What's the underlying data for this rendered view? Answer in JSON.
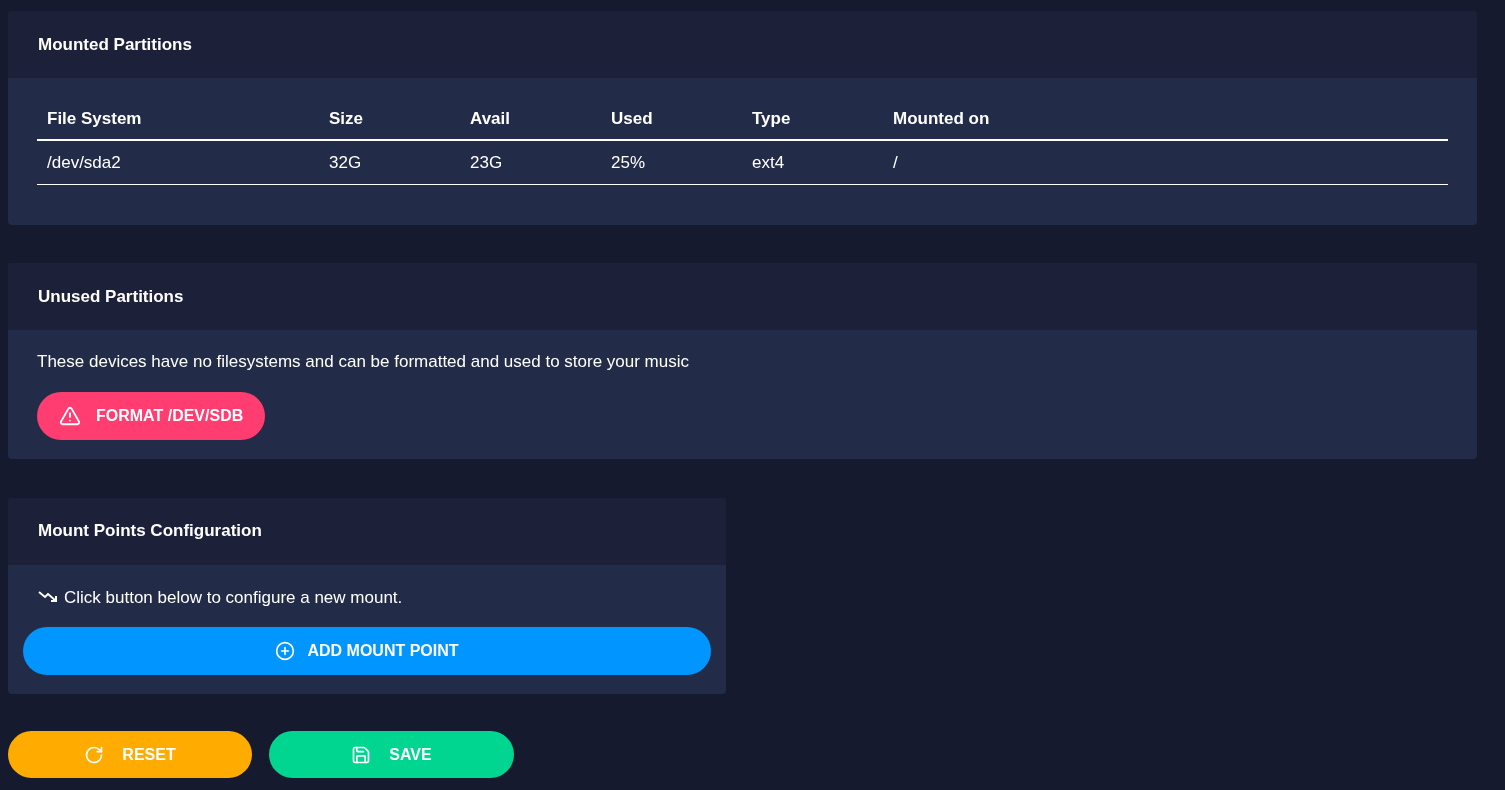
{
  "mounted_partitions": {
    "title": "Mounted Partitions",
    "table": {
      "columns": [
        "File System",
        "Size",
        "Avail",
        "Used",
        "Type",
        "Mounted on"
      ],
      "rows": [
        [
          "/dev/sda2",
          "32G",
          "23G",
          "25%",
          "ext4",
          "/"
        ]
      ]
    }
  },
  "unused_partitions": {
    "title": "Unused Partitions",
    "description": "These devices have no filesystems and can be formatted and used to store your music",
    "format_button": "FORMAT /DEV/SDB"
  },
  "mount_points": {
    "title": "Mount Points Configuration",
    "hint": "Click button below to configure a new mount.",
    "add_button": "ADD MOUNT POINT"
  },
  "actions": [
    {
      "kind": "reset",
      "label": "RESET"
    },
    {
      "kind": "save",
      "label": "SAVE"
    }
  ]
}
